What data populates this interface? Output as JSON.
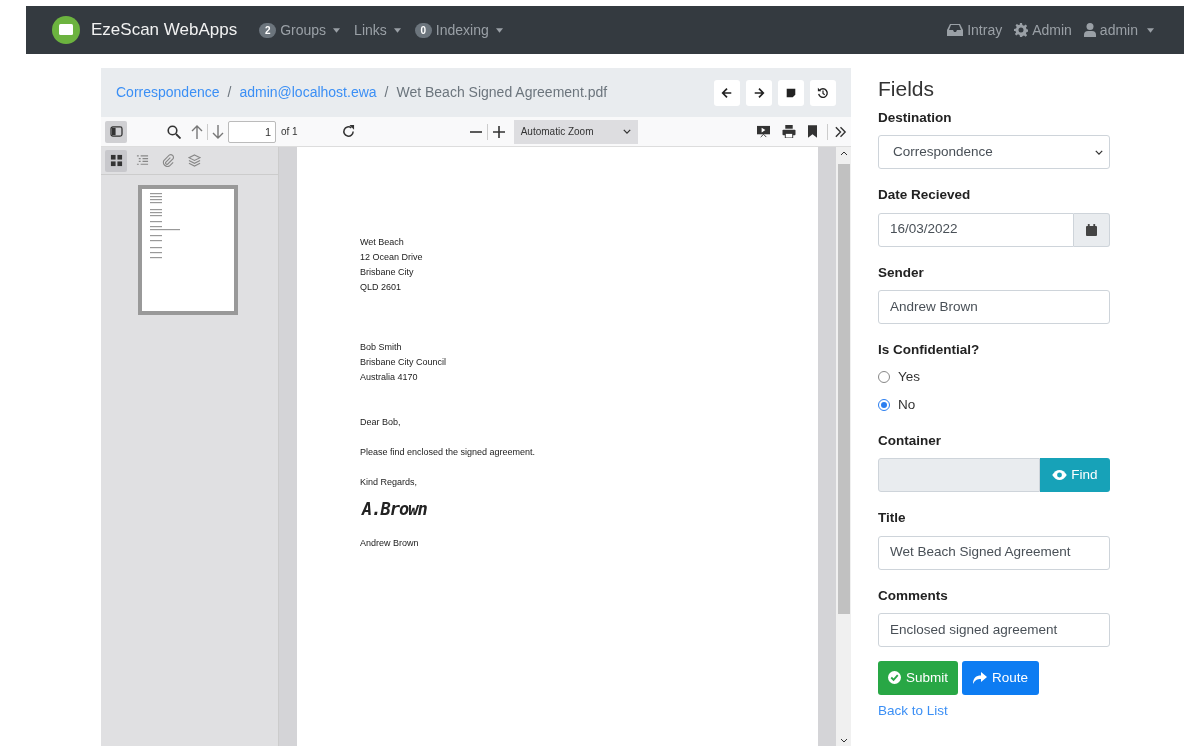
{
  "navbar": {
    "brand": "EzeScan WebApps",
    "menus": [
      {
        "badge": "2",
        "label": "Groups"
      },
      {
        "label": "Links"
      },
      {
        "badge": "0",
        "label": "Indexing"
      }
    ],
    "right": [
      {
        "label": "Intray",
        "caret": false
      },
      {
        "label": "Admin",
        "caret": false
      },
      {
        "label": "admin",
        "caret": true
      }
    ]
  },
  "viewer": {
    "breadcrumb": [
      {
        "kind": "link",
        "text": "Correspondence"
      },
      {
        "kind": "separator",
        "text": "/"
      },
      {
        "kind": "link",
        "text": "admin@localhost.ewa"
      },
      {
        "kind": "separator",
        "text": "/"
      },
      {
        "kind": "current",
        "text": "Wet Beach Signed Agreement.pdf"
      }
    ],
    "toolbar": {
      "sidebar_toggle_on": true,
      "page": "1",
      "page_count": "of 1",
      "zoom": "Automatic Zoom"
    },
    "sidebar_views": [
      {
        "selected": true
      },
      {
        "selected": false
      },
      {
        "selected": false
      },
      {
        "selected": false
      }
    ],
    "document": {
      "blocks": [
        [
          "Wet Beach",
          "12 Ocean Drive",
          "Brisbane City",
          "QLD 2601"
        ],
        [
          "Bob Smith",
          "Brisbane City Council",
          "Australia 4170"
        ],
        [
          "Dear Bob,"
        ],
        [
          "Please find enclosed the signed agreement."
        ],
        [
          "Kind Regards,"
        ]
      ],
      "signature": "A.Brown",
      "signed_name": "Andrew Brown"
    }
  },
  "fields": {
    "heading": "Fields",
    "items": [
      {
        "kind": "select",
        "label": "Destination",
        "value": "Correspondence"
      },
      {
        "kind": "date",
        "label": "Date Recieved",
        "value": "16/03/2022"
      },
      {
        "kind": "text",
        "label": "Sender",
        "value": "Andrew Brown"
      },
      {
        "kind": "radio",
        "label": "Is Confidential?",
        "options": [
          {
            "label": "Yes",
            "selected": false
          },
          {
            "label": "No",
            "selected": true
          }
        ]
      },
      {
        "kind": "lookup",
        "label": "Container",
        "button": "Find"
      },
      {
        "kind": "text",
        "label": "Title",
        "value": "Wet Beach Signed Agreement"
      },
      {
        "kind": "text",
        "label": "Comments",
        "value": "Enclosed signed agreement"
      }
    ],
    "submit": "Submit",
    "route": "Route",
    "back": "Back to List"
  }
}
